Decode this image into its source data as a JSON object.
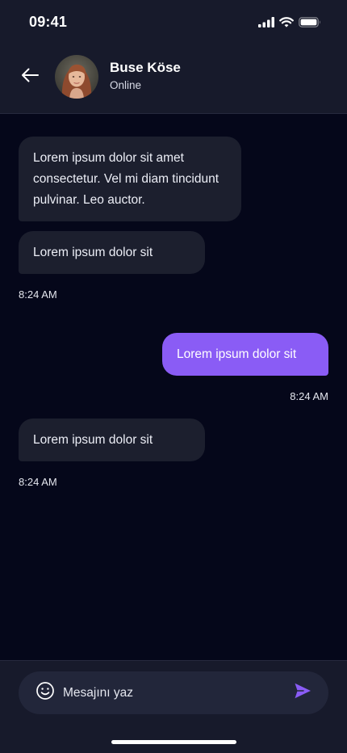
{
  "status_bar": {
    "time": "09:41"
  },
  "header": {
    "contact_name": "Buse Köse",
    "contact_status": "Online",
    "back_icon": "arrow-left-icon",
    "avatar": "contact-avatar-photo"
  },
  "messages": [
    {
      "direction": "incoming",
      "text": "Lorem ipsum dolor sit amet consectetur. Vel mi diam tincidunt pulvinar. Leo auctor."
    },
    {
      "direction": "incoming",
      "text": "Lorem ipsum dolor sit",
      "time": "8:24 AM"
    },
    {
      "direction": "outgoing",
      "text": "Lorem ipsum dolor sit",
      "time": "8:24 AM"
    },
    {
      "direction": "incoming",
      "text": "Lorem ipsum dolor sit",
      "time": "8:24 AM"
    }
  ],
  "composer": {
    "placeholder": "Mesajını yaz",
    "emoji_icon": "emoji-smile-icon",
    "send_icon": "send-icon"
  },
  "colors": {
    "background": "#05071A",
    "header": "#171A2B",
    "incoming_bubble": "#1C1F2E",
    "outgoing_bubble": "#8A5CF5",
    "accent": "#8A5CF5"
  }
}
